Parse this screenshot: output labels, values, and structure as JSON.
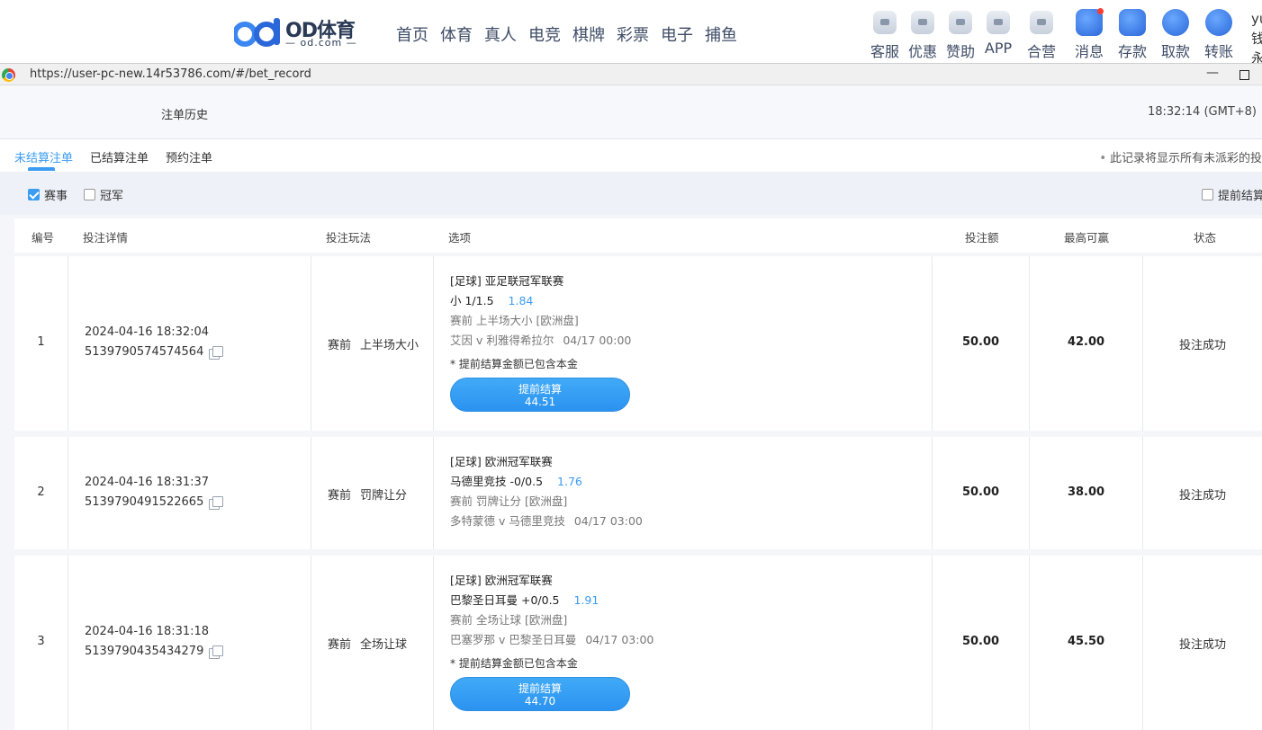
{
  "header": {
    "logo_brand": "OD体育",
    "logo_sub": "— od.com —",
    "nav": [
      "首页",
      "体育",
      "真人",
      "电竞",
      "棋牌",
      "彩票",
      "电子",
      "捕鱼"
    ],
    "quick_links": [
      "客服",
      "优惠",
      "赞助",
      "APP",
      "合营"
    ],
    "action_links": [
      "消息",
      "存款",
      "取款",
      "转账"
    ],
    "user_peek": "yu 钱 永"
  },
  "window": {
    "url": "https://user-pc-new.14r53786.com/#/bet_record",
    "minimize": "—"
  },
  "page": {
    "title": "注单历史",
    "clock": "18:32:14 (GMT+8)"
  },
  "tabs": {
    "items": [
      "未结算注单",
      "已结算注单",
      "预约注单"
    ],
    "active": 0,
    "note": "此记录将显示所有未派彩的投"
  },
  "filters": {
    "match": "赛事",
    "match_checked": true,
    "champion": "冠军",
    "champion_checked": false,
    "early_settle": "提前结算"
  },
  "table": {
    "columns": [
      "编号",
      "投注详情",
      "投注玩法",
      "选项",
      "投注额",
      "最高可赢",
      "状态"
    ],
    "rows": [
      {
        "no": "1",
        "time": "2024-04-16 18:32:04",
        "id": "5139790574574564",
        "stage": "赛前",
        "market": "上半场大小",
        "league": "[足球] 亚足联冠军联赛",
        "selection": "小 1/1.5",
        "odds": "1.84",
        "detail": "赛前 上半场大小 [欧洲盘]",
        "teams": "艾因 v 利雅得希拉尔",
        "date": "04/17 00:00",
        "note": "* 提前结算金额已包含本金",
        "btn_label": "提前结算",
        "btn_value": "44.51",
        "amount": "50.00",
        "max_win": "42.00",
        "status": "投注成功"
      },
      {
        "no": "2",
        "time": "2024-04-16 18:31:37",
        "id": "5139790491522665",
        "stage": "赛前",
        "market": "罚牌让分",
        "league": "[足球] 欧洲冠军联赛",
        "selection": "马德里竞技 -0/0.5",
        "odds": "1.76",
        "detail": "赛前 罚牌让分 [欧洲盘]",
        "teams": "多特蒙德 v 马德里竞技",
        "date": "04/17 03:00",
        "amount": "50.00",
        "max_win": "38.00",
        "status": "投注成功"
      },
      {
        "no": "3",
        "time": "2024-04-16 18:31:18",
        "id": "5139790435434279",
        "stage": "赛前",
        "market": "全场让球",
        "league": "[足球] 欧洲冠军联赛",
        "selection": "巴黎圣日耳曼 +0/0.5",
        "odds": "1.91",
        "detail": "赛前 全场让球 [欧洲盘]",
        "teams": "巴塞罗那 v 巴黎圣日耳曼",
        "date": "04/17 03:00",
        "note": "* 提前结算金额已包含本金",
        "btn_label": "提前结算",
        "btn_value": "44.70",
        "amount": "50.00",
        "max_win": "45.50",
        "status": "投注成功"
      }
    ]
  }
}
